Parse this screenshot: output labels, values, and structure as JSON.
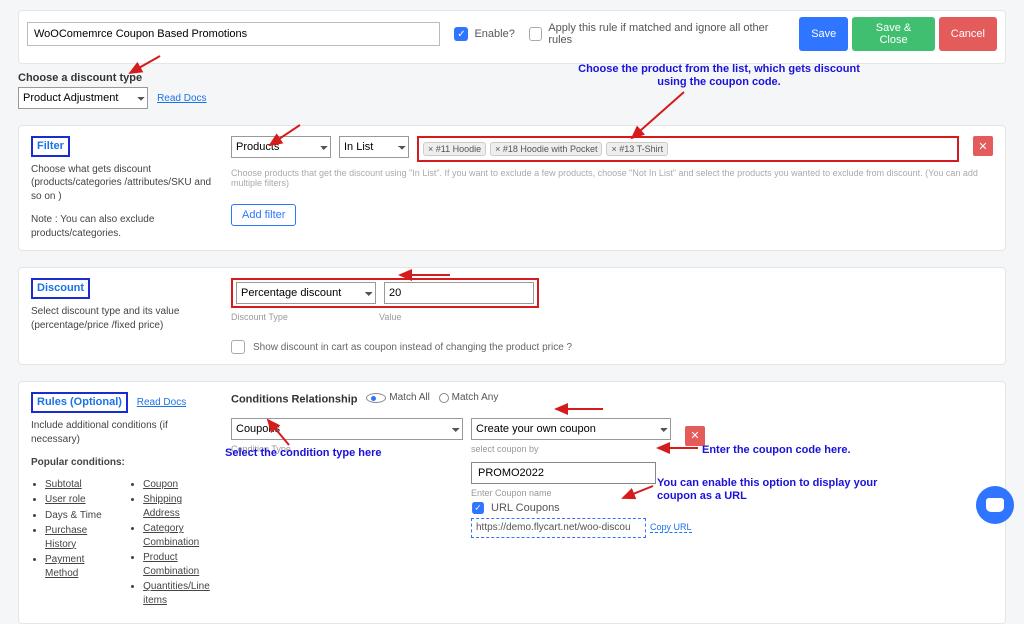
{
  "topbar": {
    "rule_name": "WoOComemrce Coupon Based Promotions",
    "enable_label": "Enable?",
    "apply_label": "Apply this rule if matched and ignore all other rules",
    "buttons": {
      "save": "Save",
      "save_close": "Save & Close",
      "cancel": "Cancel"
    },
    "discount_type_title": "Choose a discount type",
    "discount_type_value": "Product Adjustment",
    "read_docs": "Read Docs"
  },
  "annotations": {
    "product_note": "Choose the product from the list, which gets discount using the coupon code.",
    "cond_type_note": "Select the condition type here",
    "coupon_note": "Enter the coupon code here.",
    "url_note": "You can enable this option to display your coupon as a URL"
  },
  "filter": {
    "badge": "Filter",
    "desc1": "Choose what gets discount (products/categories /attributes/SKU and so on )",
    "desc2": "Note : You can also exclude products/categories.",
    "sel_products": "Products",
    "sel_inlist": "In List",
    "tags": [
      "× #11 Hoodie",
      "× #18 Hoodie with Pocket",
      "× #13 T-Shirt"
    ],
    "help": "Choose products that get the discount using \"In List\". If you want to exclude a few products, choose \"Not In List\" and select the products you wanted to exclude from discount.  (You can add multiple filters)",
    "add_filter": "Add filter"
  },
  "discount": {
    "badge": "Discount",
    "desc": "Select discount type and its value (percentage/price /fixed price)",
    "type_value": "Percentage discount",
    "value_value": "20",
    "type_label": "Discount Type",
    "value_label": "Value",
    "coupon_chk": "Show discount in cart as coupon instead of changing the product price ?"
  },
  "rules": {
    "badge": "Rules (Optional)",
    "read_docs": "Read Docs",
    "desc": "Include additional conditions (if necessary)",
    "popular_title": "Popular conditions:",
    "popular_col1": [
      "Subtotal",
      "User role",
      "Days & Time",
      "Purchase History",
      "Payment Method"
    ],
    "popular_col2": [
      "Coupon",
      "Shipping Address",
      "Category Combination",
      "Product Combination",
      "Quantities/Line items"
    ],
    "rel_title": "Conditions Relationship",
    "match_all": "Match All",
    "match_any": "Match Any",
    "cond_type_value": "Coupons",
    "cond_type_label": "Condition Type",
    "coupon_by_value": "Create your own coupon",
    "coupon_by_label": "select coupon by",
    "coupon_input": "PROMO2022",
    "enter_coupon_label": "Enter Coupon name",
    "url_coupons_label": "URL Coupons",
    "url_value": "https://demo.flycart.net/woo-discou",
    "copy_url": "Copy URL"
  }
}
